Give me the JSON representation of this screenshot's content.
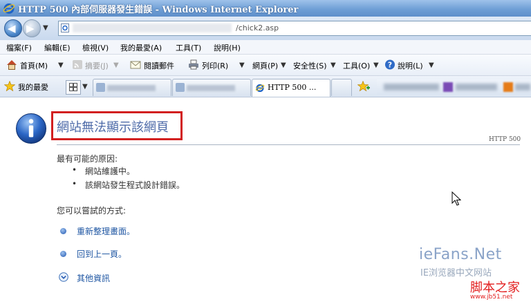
{
  "window": {
    "title": "HTTP 500 內部伺服器發生錯誤 - Windows Internet Explorer"
  },
  "address": {
    "url_visible": "/chick2.asp"
  },
  "menu": {
    "items": [
      "檔案(F)",
      "編輯(E)",
      "檢視(V)",
      "我的最愛(A)",
      "工具(T)",
      "說明(H)"
    ]
  },
  "command": {
    "home": "首頁(M)",
    "feeds": "摘要(J)",
    "read_mail": "閱讀郵件",
    "print": "列印(R)",
    "page": "網頁(P)",
    "safety": "安全性(S)",
    "tools": "工具(O)",
    "help": "說明(L)"
  },
  "favorites": {
    "label": "我的最愛"
  },
  "tabs": {
    "active_label": "HTTP 500 ..."
  },
  "content": {
    "title": "網站無法顯示該網頁",
    "code": "HTTP 500",
    "causes_heading": "最有可能的原因:",
    "causes": [
      "網站維護中。",
      "該網站發生程式設計錯誤。"
    ],
    "try_heading": "您可以嘗試的方式:",
    "actions": [
      "重新整理畫面。",
      "回到上一頁。"
    ],
    "more_info": "其他資訊"
  },
  "watermark": {
    "site": "ieFans.Net",
    "site_sub": "IE浏览器中文网站",
    "brand": "脚本之家",
    "brand_url": "www.jb51.net"
  },
  "colors": {
    "highlight": "#d21f1f",
    "link": "#2057a3",
    "title": "#4d6aa8"
  }
}
